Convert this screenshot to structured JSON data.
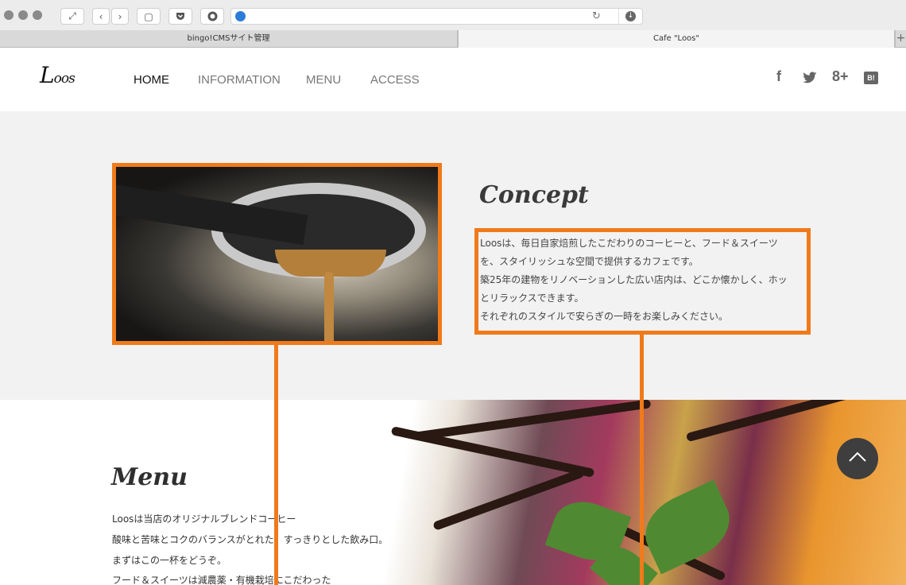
{
  "browser": {
    "tabs": [
      {
        "label": "bingo!CMSサイト管理",
        "active": false
      },
      {
        "label": "Cafe \"Loos\"",
        "active": true
      }
    ],
    "new_tab_label": "+"
  },
  "site": {
    "logo_main": "L",
    "logo_rest": "oos",
    "nav": [
      "HOME",
      "INFORMATION",
      "MENU",
      "ACCESS"
    ],
    "nav_active": "HOME",
    "social": {
      "facebook": "f",
      "google_plus": "8+",
      "hatena": "B!"
    }
  },
  "concept": {
    "title": "Concept",
    "lines": [
      "Loosは、毎日自家焙煎したこだわりのコーヒーと、フード＆スイーツ",
      "を、スタイリッシュな空間で提供するカフェです。",
      "築25年の建物をリノベーションした広い店内は、どこか懐かしく、ホッ",
      "とリラックスできます。",
      "それぞれのスタイルで安らぎの一時をお楽しみください。"
    ]
  },
  "menu": {
    "title": "Menu",
    "lines": [
      "Loosは当店のオリジナルブレンドコーヒー",
      "酸味と苦味とコクのバランスがとれた、すっきりとした飲み口。",
      "まずはこの一杯をどうぞ。",
      "フード＆スイーツは減農薬・有機栽培にこだわった"
    ]
  },
  "colors": {
    "annotation": "#f07a1a",
    "concept_bg": "#f2f2f2",
    "scroll_top_bg": "#3e3e3e"
  },
  "icons": [
    "fullscreen-icon",
    "back-icon",
    "forward-icon",
    "reader-icon",
    "pocket-icon",
    "extension-icon",
    "globe-icon",
    "reload-icon",
    "download-icon",
    "facebook-icon",
    "twitter-icon",
    "google-plus-icon",
    "hatena-bookmark-icon",
    "chevron-up-icon"
  ]
}
